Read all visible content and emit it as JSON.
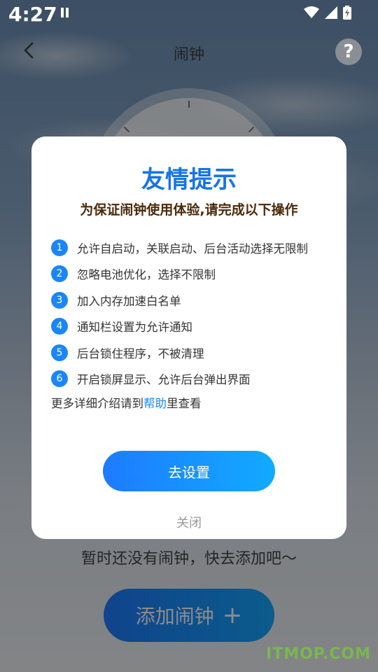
{
  "status_bar": {
    "time": "4:27"
  },
  "header": {
    "title": "闹钟"
  },
  "main": {
    "empty_text": "暂时还没有闹钟，快去添加吧～",
    "add_button_label": "添加闹钟",
    "add_button_icon": "+"
  },
  "dialog": {
    "title": "友情提示",
    "subtitle": "为保证闹钟使用体验,请完成以下操作",
    "steps": [
      {
        "num": "1",
        "text": "允许自启动，关联启动、后台活动选择无限制"
      },
      {
        "num": "2",
        "text": "忽略电池优化，选择不限制"
      },
      {
        "num": "3",
        "text": "加入内存加速白名单"
      },
      {
        "num": "4",
        "text": "通知栏设置为允许通知"
      },
      {
        "num": "5",
        "text": "后台锁住程序，不被清理"
      },
      {
        "num": "6",
        "text": "开启锁屏显示、允许后台弹出界面"
      }
    ],
    "more_prefix": "更多详细介绍请到",
    "more_link": "帮助",
    "more_suffix": "里查看",
    "confirm_label": "去设置",
    "close_label": "关闭"
  },
  "watermark": "ITMOP.COM",
  "colors": {
    "accent": "#1b86f5",
    "title_blue": "#1674e6",
    "subtitle_brown": "#4a2a0a"
  }
}
